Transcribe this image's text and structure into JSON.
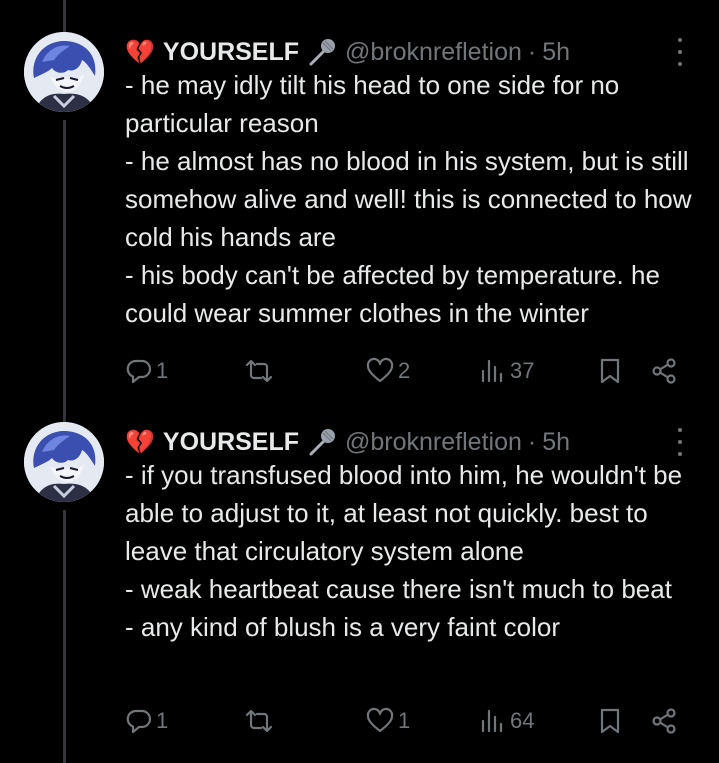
{
  "tweets": [
    {
      "display_name": "YOURSELF",
      "handle": "@broknrefletion",
      "separator": "·",
      "time": "5h",
      "name_emoji": "💔",
      "lines": [
        "- he may idly tilt his head to one side for no particular reason",
        "- he almost has no blood in his system, but is still somehow alive and well! this is connected to how cold his hands are",
        "- his body can't be affected by temperature. he could wear summer clothes in the winter"
      ],
      "replies": "1",
      "reposts": "",
      "likes": "2",
      "views": "37"
    },
    {
      "display_name": "YOURSELF",
      "handle": "@broknrefletion",
      "separator": "·",
      "time": "5h",
      "name_emoji": "💔",
      "lines": [
        "- if you transfused blood into him, he wouldn't be able to adjust to it, at least not quickly. best to leave that circulatory system alone",
        "- weak heartbeat cause there isn't much to beat",
        "- any kind of blush is a very faint color"
      ],
      "replies": "1",
      "reposts": "",
      "likes": "1",
      "views": "64"
    }
  ],
  "icons": [
    "broken-heart-icon",
    "microphone-icon",
    "more-icon",
    "reply-icon",
    "repost-icon",
    "like-icon",
    "views-icon",
    "bookmark-icon",
    "share-icon"
  ],
  "colors": {
    "background": "#000000",
    "text": "#e7e9ea",
    "muted": "#71767b",
    "thread_line": "#333639"
  }
}
